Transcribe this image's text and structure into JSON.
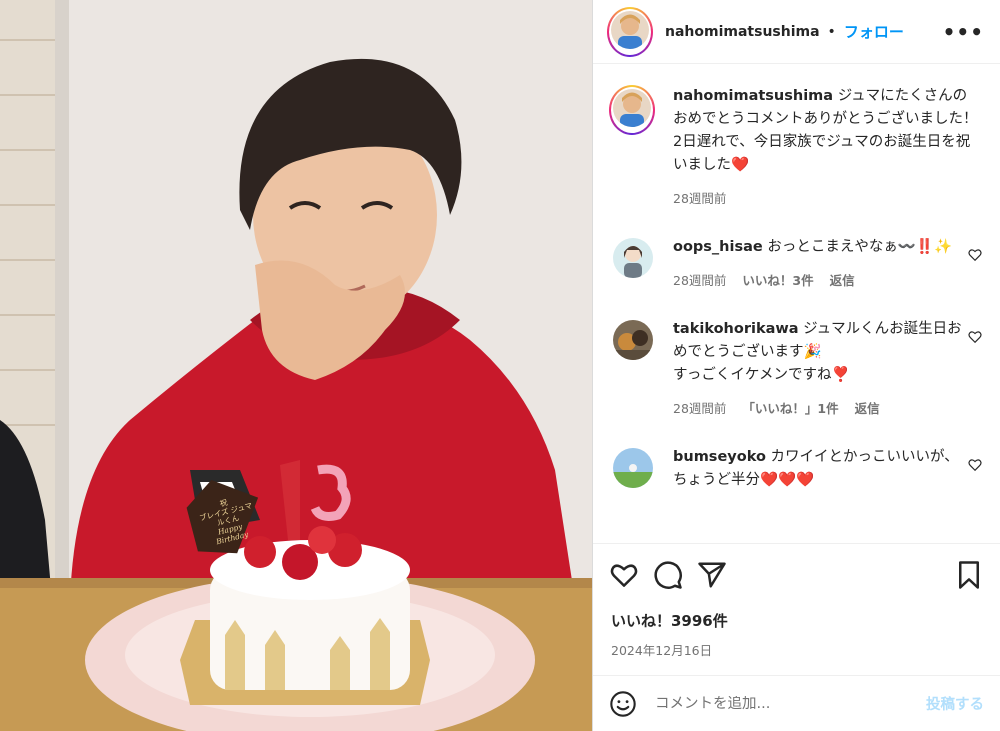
{
  "post": {
    "username": "nahomimatsushima",
    "dot": "•",
    "follow_label": "フォロー",
    "more_label": "•••"
  },
  "caption": {
    "username": "nahomimatsushima",
    "text_lines": [
      "ジュマにたくさんのおめでとうコメントありがとうございました！",
      "2日遅れで、今日家族でジュマのお誕生日を祝いました❤️"
    ],
    "time": "28週間前"
  },
  "comments": [
    {
      "username": "oops_hisae",
      "text": "おっとこまえやなぁ〰️‼️✨",
      "time": "28週間前",
      "likes": "いいね！3件",
      "reply": "返信"
    },
    {
      "username": "takikohorikawa",
      "text_lines": [
        "ジュマルくんお誕生日おめでとうございます🎉",
        "すっごくイケメンですね❣️"
      ],
      "time": "28週間前",
      "likes": "「いいね！」1件",
      "reply": "返信"
    },
    {
      "username": "bumseyoko",
      "text": "カワイイとかっこいいいが、ちょうど半分❤️❤️❤️"
    }
  ],
  "likes_count": "いいね！3996件",
  "date": "2024年12月16日",
  "composer": {
    "placeholder": "コメントを追加...",
    "post_label": "投稿する"
  },
  "cake": {
    "plaque_lines": [
      "祝",
      "ブレイズ ジュマルくん",
      "Happy",
      "Birthday"
    ],
    "candle_digits": [
      "1",
      "3"
    ]
  },
  "colors": {
    "accent": "#0095f6",
    "heart": "#ed4956",
    "text_secondary": "#737373"
  }
}
